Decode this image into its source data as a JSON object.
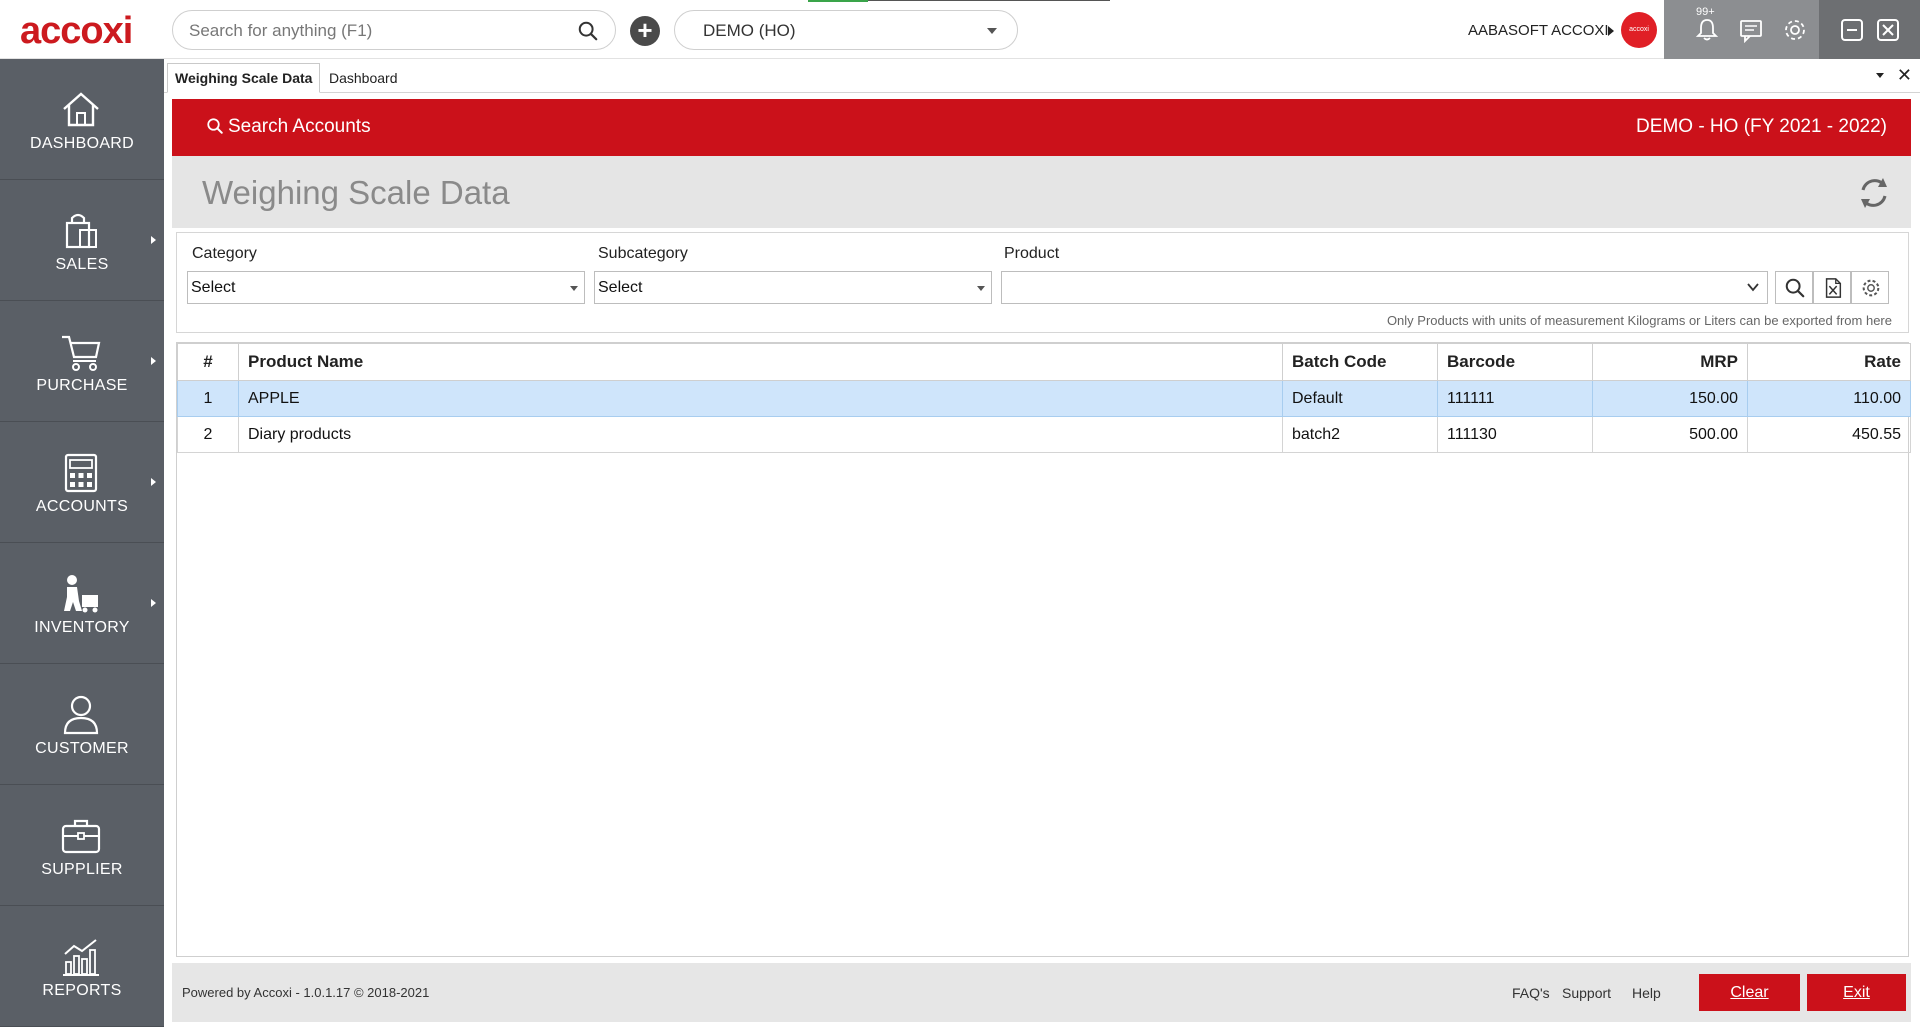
{
  "topbar": {
    "logo": "accoxi",
    "search_placeholder": "Search for anything (F1)",
    "company": "DEMO (HO)",
    "user_name": "AABASOFT ACCOXI",
    "avatar_text": "accoxi",
    "notification_badge": "99+"
  },
  "sidebar": {
    "items": [
      {
        "label": "DASHBOARD",
        "icon": "home-icon"
      },
      {
        "label": "SALES",
        "icon": "shopping-bag-icon"
      },
      {
        "label": "PURCHASE",
        "icon": "cart-icon"
      },
      {
        "label": "ACCOUNTS",
        "icon": "calculator-icon"
      },
      {
        "label": "INVENTORY",
        "icon": "worker-icon"
      },
      {
        "label": "CUSTOMER",
        "icon": "person-icon"
      },
      {
        "label": "SUPPLIER",
        "icon": "briefcase-icon"
      },
      {
        "label": "REPORTS",
        "icon": "bar-chart-icon"
      }
    ]
  },
  "tabs": [
    {
      "label": "Weighing Scale Data",
      "active": true
    },
    {
      "label": "Dashboard",
      "active": false
    }
  ],
  "banner": {
    "search_label": "Search Accounts",
    "company_label": "DEMO - HO (FY 2021 - 2022)"
  },
  "page": {
    "title": "Weighing Scale Data"
  },
  "filters": {
    "category_label": "Category",
    "category_value": "Select",
    "subcategory_label": "Subcategory",
    "subcategory_value": "Select",
    "product_label": "Product",
    "product_value": "",
    "note": "Only Products with units of measurement Kilograms or Liters can be exported from here"
  },
  "table": {
    "columns": [
      "#",
      "Product Name",
      "Batch Code",
      "Barcode",
      "MRP",
      "Rate"
    ],
    "rows": [
      {
        "idx": "1",
        "name": "APPLE",
        "batch": "Default",
        "barcode": "111111",
        "mrp": "150.00",
        "rate": "110.00",
        "selected": true
      },
      {
        "idx": "2",
        "name": "Diary products",
        "batch": "batch2",
        "barcode": "111130",
        "mrp": "500.00",
        "rate": "450.55",
        "selected": false
      }
    ]
  },
  "footer": {
    "powered": "Powered by Accoxi - 1.0.1.17 © 2018-2021",
    "faqs": "FAQ's",
    "support": "Support",
    "help": "Help",
    "clear": "Clear",
    "exit": "Exit"
  },
  "colors": {
    "brand_red": "#cb111a",
    "sidebar": "#5a5f66",
    "selected_row": "#cfe5fb"
  }
}
